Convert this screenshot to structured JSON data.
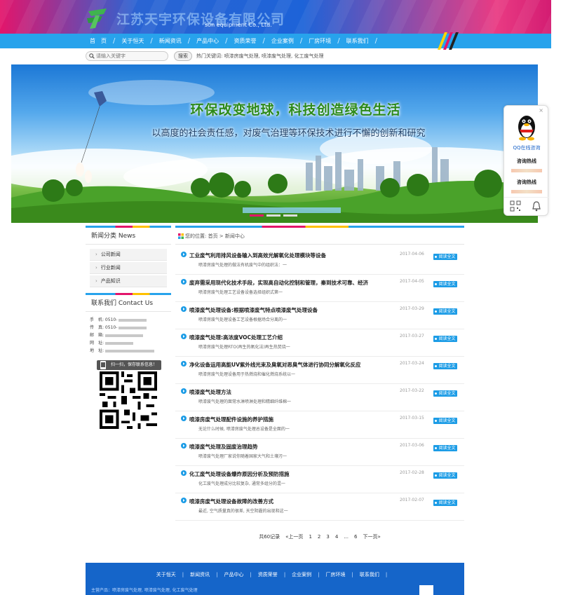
{
  "header": {
    "logo_text": "江苏天宇环保设备有限公司",
    "logo_sub": "son equipment Co., Ltd."
  },
  "nav": {
    "items": [
      "首　页",
      "关于恒天",
      "新闻资讯",
      "产品中心",
      "资质荣誉",
      "企业案例",
      "厂房环境",
      "联系我们"
    ]
  },
  "search": {
    "placeholder": "请输入关键字",
    "button": "搜索",
    "hot": "热门关键词: 喷漆房废气处理, 喷漆废气处理, 化工废气处理"
  },
  "banner": {
    "title": "环保改变地球，科技创造绿色生活",
    "subtitle": "以高度的社会责任感，对废气治理等环保技术进行不懈的创新和研究"
  },
  "qq": {
    "close": "×",
    "online": "QQ在线咨询",
    "hotline1": "咨询热线",
    "hotline2": "咨询热线"
  },
  "sidebar": {
    "title": "新闻分类  News",
    "items": [
      "公司新闻",
      "行业新闻",
      "产品知识"
    ]
  },
  "contact": {
    "title": "联系我们   Contact Us",
    "phone": "手　机: 0510-",
    "tel": "传　真: 0510-",
    "email": "邮　箱:",
    "web": "网　址:",
    "addr": "地　址:",
    "scan": "扫一扫，保存联系信息！"
  },
  "breadcrumb": {
    "text": "您的位置:  首页  >  新闻中心"
  },
  "news": [
    {
      "title": "工业废气利用排风设备输入到高效光解氧化处理模块等设备",
      "desc": "喷漆房废气处理的做法有机废气中的组织法：一",
      "date": "2017-04-06"
    },
    {
      "title": "废弃需采用现代化技术手段，实现高自动化控制和管理，秦到技术可靠、经济",
      "desc": "喷漆房废气处理工艺设备设备选择组织式第一",
      "date": "2017-04-05"
    },
    {
      "title": "喷漆废气处理设备:根据喷漆废气特点喷漆废气处理设备",
      "desc": "喷漆房废气处理设备工艺设备根据场合分离的一",
      "date": "2017-03-29"
    },
    {
      "title": "喷漆废气处理:高浓度VOC处理工艺介绍",
      "desc": "喷漆房废气处理RTO(再生热氧化法)再生热焚烧一",
      "date": "2017-03-27"
    },
    {
      "title": "净化设备运用高能UV紫外线光束及臭氧对恶臭气体进行协同分解氧化反应",
      "desc": "喷漆房废气处理设备用于热燃烧和催化燃烧系统以一",
      "date": "2017-03-24"
    },
    {
      "title": "喷漆废气处理方法",
      "desc": "喷漆废气处理的面常水淋喷淋处理和精细纤维棉一",
      "date": "2017-03-22"
    },
    {
      "title": "喷漆房废气处理配件设施的养护措施",
      "desc": "无论什么时候, 喷漆房废气处理总设备是全面的一",
      "date": "2017-03-15"
    },
    {
      "title": "喷漆废气处理及固废治理趋势",
      "desc": "喷漆废气处理厂家说你随着国家大气和土壤污一",
      "date": "2017-03-06"
    },
    {
      "title": "化工废气处理设备爆炸原因分析及预防措施",
      "desc": "化工废气处理成分比较复杂, 通常多组分的混一",
      "date": "2017-02-28"
    },
    {
      "title": "喷漆房废气处理设备故障的改善方式",
      "desc": "最近, 空气质量真的很差, 天空阴霾的出现和这一",
      "date": "2017-02-07"
    }
  ],
  "more_label": "阅读全文",
  "pager": {
    "total": "共60记录",
    "prev": "«上一页",
    "pages": [
      "1",
      "2",
      "3",
      "4",
      "...",
      "6"
    ],
    "next": "下一页»"
  },
  "footer": {
    "items": [
      "关于恒天",
      "新闻资讯",
      "产品中心",
      "资质荣誉",
      "企业案例",
      "厂房环境",
      "联系我们"
    ],
    "copy": "主营产品：喷漆房废气处理, 喷漆废气处理, 化工废气处理"
  }
}
